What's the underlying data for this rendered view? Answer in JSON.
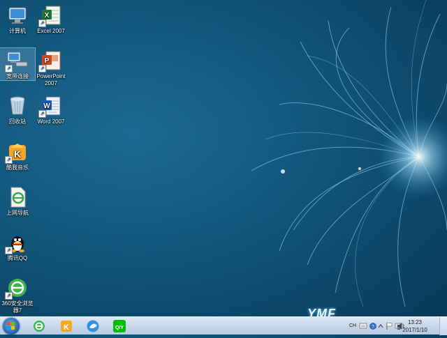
{
  "desktop": {
    "icons": [
      {
        "label": "计算机",
        "icon": "computer-icon"
      },
      {
        "label": "Excel 2007",
        "icon": "excel-icon"
      },
      {
        "label": "宽带连接",
        "icon": "broadband-icon"
      },
      {
        "label": "PowerPoint 2007",
        "icon": "powerpoint-icon"
      },
      {
        "label": "回收站",
        "icon": "recycle-bin-icon"
      },
      {
        "label": "Word 2007",
        "icon": "word-icon"
      },
      {
        "label": "酷我音乐",
        "icon": "kuwo-music-icon"
      },
      {
        "label": "上网导航",
        "icon": "web-nav-icon"
      },
      {
        "label": "腾讯QQ",
        "icon": "qq-icon"
      },
      {
        "label": "360安全浏览器7",
        "icon": "360-browser-icon"
      }
    ],
    "wallpaper_logo": "YMF"
  },
  "taskbar": {
    "start_icon": "windows-start-icon",
    "pinned": [
      {
        "name": "ie-icon"
      },
      {
        "name": "kuwo-icon"
      },
      {
        "name": "browser-icon"
      },
      {
        "name": "iqiyi-icon"
      }
    ],
    "tray": {
      "lang": "CH"
    },
    "clock": {
      "time": "13:23",
      "date": "2017/1/10"
    }
  },
  "colors": {
    "desktop_bg": "#11577c",
    "taskbar_bg": "#c7d7ea"
  }
}
